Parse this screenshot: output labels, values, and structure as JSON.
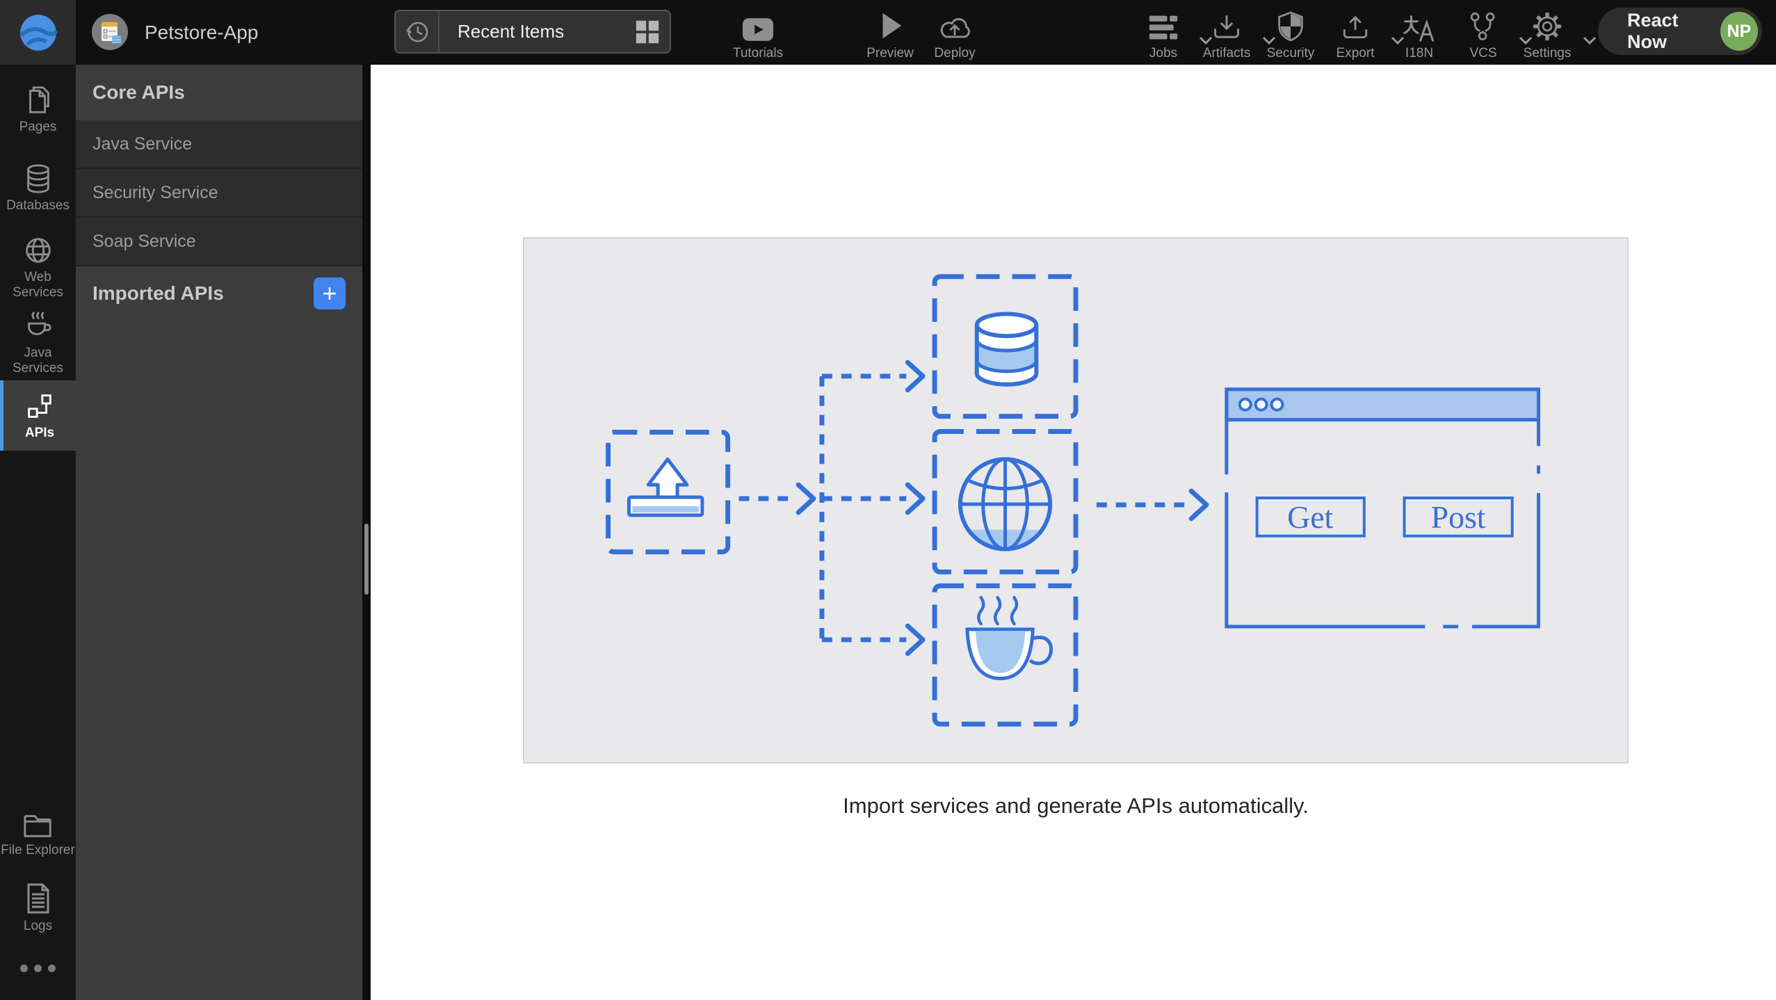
{
  "topbar": {
    "app_title": "Petstore-App",
    "recent_items": {
      "label": "Recent Items"
    },
    "left_actions": [
      {
        "label": "Tutorials"
      },
      {
        "label": "Preview"
      },
      {
        "label": "Deploy"
      }
    ],
    "right_actions": [
      {
        "label": "Jobs",
        "caret": true
      },
      {
        "label": "Artifacts",
        "caret": true
      },
      {
        "label": "Security",
        "caret": false
      },
      {
        "label": "Export",
        "caret": true
      },
      {
        "label": "I18N",
        "caret": false
      },
      {
        "label": "VCS",
        "caret": true
      },
      {
        "label": "Settings",
        "caret": true
      }
    ],
    "react_now": {
      "label": "React Now",
      "avatar_initials": "NP"
    }
  },
  "sidebar": {
    "items": [
      {
        "label": "Pages",
        "icon": "pages-icon",
        "active": false
      },
      {
        "label": "Databases",
        "icon": "database-icon",
        "active": false
      },
      {
        "label": "Web Services",
        "icon": "globe-icon",
        "active": false
      },
      {
        "label": "Java Services",
        "icon": "coffee-icon",
        "active": false
      },
      {
        "label": "APIs",
        "icon": "api-nodes-icon",
        "active": true
      }
    ],
    "bottom_items": [
      {
        "label": "File Explorer",
        "icon": "folder-icon"
      },
      {
        "label": "Logs",
        "icon": "document-icon"
      }
    ]
  },
  "panel": {
    "core_header": "Core APIs",
    "items": [
      {
        "label": "Java Service"
      },
      {
        "label": "Security Service"
      },
      {
        "label": "Soap Service"
      }
    ],
    "imported_header": "Imported APIs",
    "add_button_label": "+"
  },
  "main": {
    "caption": "Import services and generate APIs automatically.",
    "diagram": {
      "get_button": "Get",
      "post_button": "Post"
    }
  },
  "colors": {
    "accent_blue": "#4084ee",
    "diagram_stroke": "#3570d8",
    "diagram_fill": "#a6c9f0",
    "avatar_green": "#79ab5c",
    "active_item_border": "#4a9ce8"
  }
}
